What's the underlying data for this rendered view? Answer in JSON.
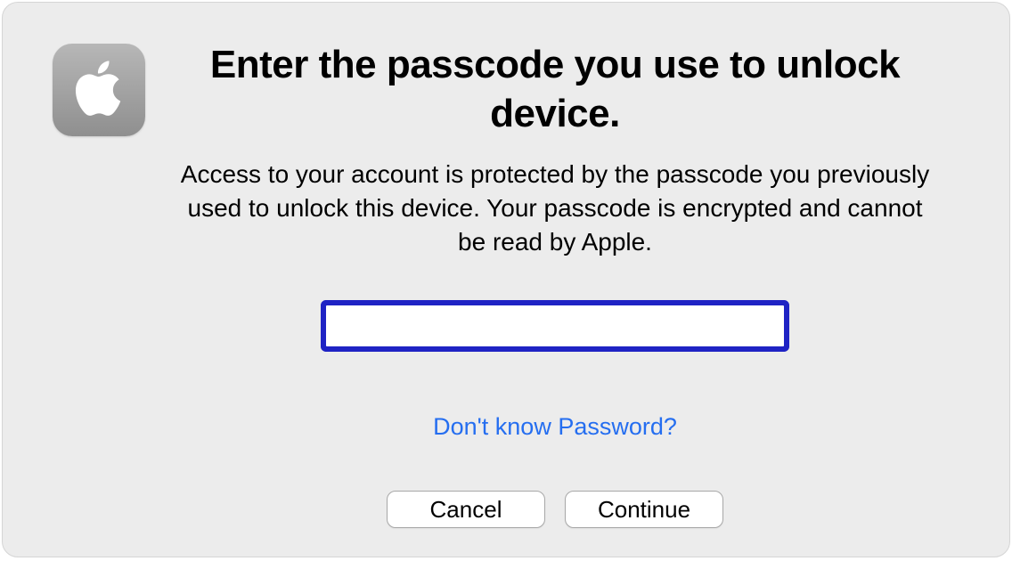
{
  "dialog": {
    "title": "Enter the passcode you use to unlock device.",
    "subtitle": "Access to your account is protected by the passcode you previously used to unlock this device. Your passcode is encrypted and cannot be read by Apple.",
    "passcode_value": "",
    "help_link": "Don't know Password?",
    "cancel_label": "Cancel",
    "continue_label": "Continue",
    "icon_name": "apple-logo-icon"
  }
}
